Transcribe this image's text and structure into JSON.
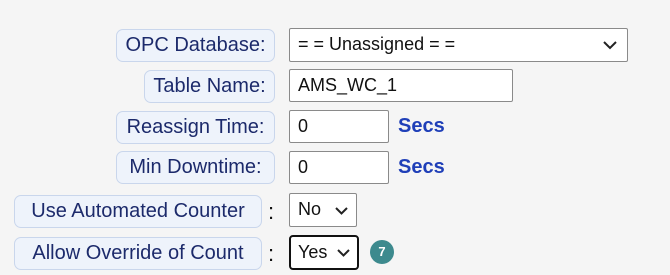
{
  "form": {
    "opc_database": {
      "label": "OPC Database:",
      "value": "= = Unassigned = ="
    },
    "table_name": {
      "label": "Table Name:",
      "value": "AMS_WC_1"
    },
    "reassign_time": {
      "label": "Reassign Time:",
      "value": "0",
      "unit": "Secs"
    },
    "min_downtime": {
      "label": "Min Downtime:",
      "value": "0",
      "unit": "Secs"
    },
    "use_automated_counter": {
      "label": "Use Automated Counter",
      "colon": ":",
      "value": "No"
    },
    "allow_override_of_count": {
      "label": "Allow Override of Count",
      "colon": ":",
      "value": "Yes",
      "badge": "7"
    }
  },
  "colors": {
    "label_text": "#1c2a6b",
    "label_bg": "#eef3fb",
    "unit_text": "#1f3fb8",
    "badge_bg": "#3d8a8e",
    "page_bg": "#f5f5f5"
  },
  "icons": {
    "dropdown": "chevron-down-icon"
  }
}
